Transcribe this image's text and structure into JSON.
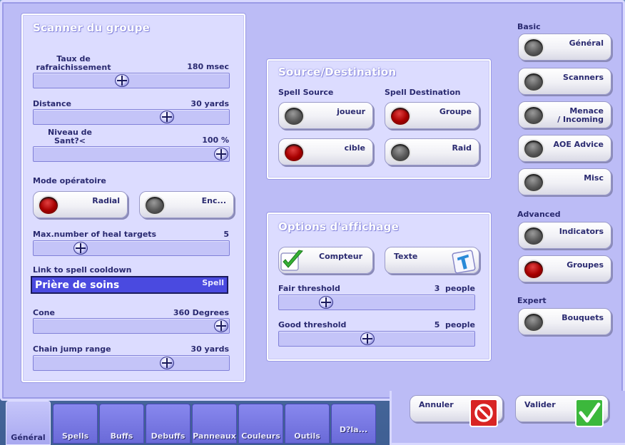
{
  "scanner": {
    "title": "Scanner du groupe",
    "refresh": {
      "label": "Taux de\nrafraichissement",
      "value": "180 msec",
      "level": 0.45
    },
    "distance": {
      "label": "Distance",
      "value": "30 yards",
      "level": 0.7
    },
    "health": {
      "label": "Niveau de\nSant?<",
      "value": "100 %",
      "level": 1.0
    },
    "mode_label": "Mode opératoire",
    "mode_radial": "Radial",
    "mode_enc": "Enc...",
    "maxheal": {
      "label": "Max.number of heal targets",
      "value": "5",
      "level": 0.22
    },
    "link_label": "Link to spell cooldown",
    "spell_name": "Prière de soins",
    "spell_tag": "Spell",
    "cone": {
      "label": "Cone",
      "value": "360 Degrees",
      "level": 1.0
    },
    "chain": {
      "label": "Chain jump range",
      "value": "30 yards",
      "level": 0.7
    }
  },
  "source": {
    "title": "Source/Destination",
    "spell_source": "Spell Source",
    "spell_dest": "Spell Destination",
    "joueur": "joueur",
    "cible": "cible",
    "groupe": "Groupe",
    "raid": "Raid"
  },
  "display": {
    "title": "Options d'affichage",
    "compteur": "Compteur",
    "texte": "Texte",
    "fair": {
      "label": "Fair threshold",
      "value": "3  people",
      "level": 0.22
    },
    "good": {
      "label": "Good threshold",
      "value": "5  people",
      "level": 0.45
    }
  },
  "right": {
    "basic": "Basic",
    "general": "Général",
    "scanners": "Scanners",
    "menace": "Menace\n/ Incoming",
    "aoe": "AOE Advice",
    "misc": "Misc",
    "advanced": "Advanced",
    "indicators": "Indicators",
    "groupes": "Groupes",
    "expert": "Expert",
    "bouquets": "Bouquets"
  },
  "footer": {
    "annuler": "Annuler",
    "valider": "Valider"
  },
  "tabs": [
    "Général",
    "Spells",
    "Buffs",
    "Debuffs",
    "Panneaux",
    "Couleurs",
    "Outils",
    "D?la..."
  ]
}
